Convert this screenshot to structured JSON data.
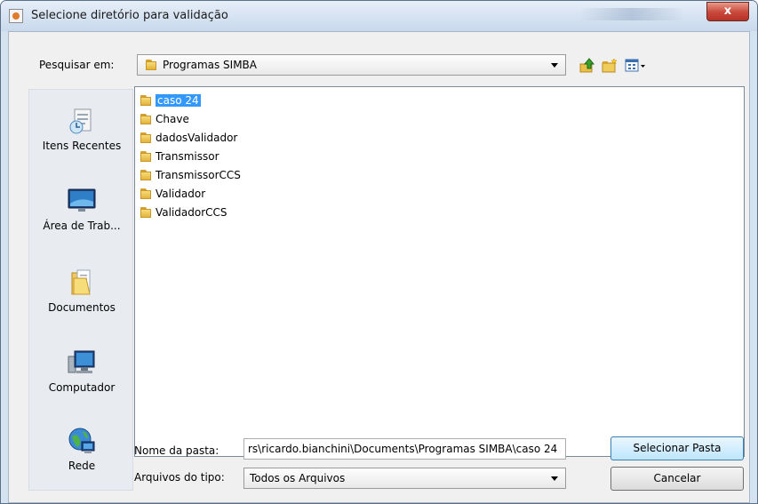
{
  "window": {
    "title": "Selecione diretório para validação",
    "close_label": "x"
  },
  "lookin": {
    "label": "Pesquisar em:",
    "value": "Programas SIMBA"
  },
  "sidebar": {
    "items": [
      {
        "label": "Itens Recentes"
      },
      {
        "label": "Área de Trab..."
      },
      {
        "label": "Documentos"
      },
      {
        "label": "Computador"
      },
      {
        "label": "Rede"
      }
    ]
  },
  "files": [
    {
      "name": "caso 24",
      "selected": true
    },
    {
      "name": "Chave"
    },
    {
      "name": "dadosValidador"
    },
    {
      "name": "Transmissor"
    },
    {
      "name": "TransmissorCCS"
    },
    {
      "name": "Validador"
    },
    {
      "name": "ValidadorCCS"
    }
  ],
  "folder_name": {
    "label": "Nome da pasta:",
    "value": "rs\\ricardo.bianchini\\Documents\\Programas SIMBA\\caso 24"
  },
  "file_type": {
    "label": "Arquivos do tipo:",
    "value": "Todos os Arquivos"
  },
  "buttons": {
    "select": "Selecionar Pasta",
    "cancel": "Cancelar"
  },
  "icons": {
    "up": "up-folder-icon",
    "new_folder": "new-folder-icon",
    "view": "view-menu-icon",
    "recent": "recent-items-icon",
    "desktop": "desktop-icon",
    "documents": "documents-icon",
    "computer": "computer-icon",
    "network": "network-icon"
  }
}
